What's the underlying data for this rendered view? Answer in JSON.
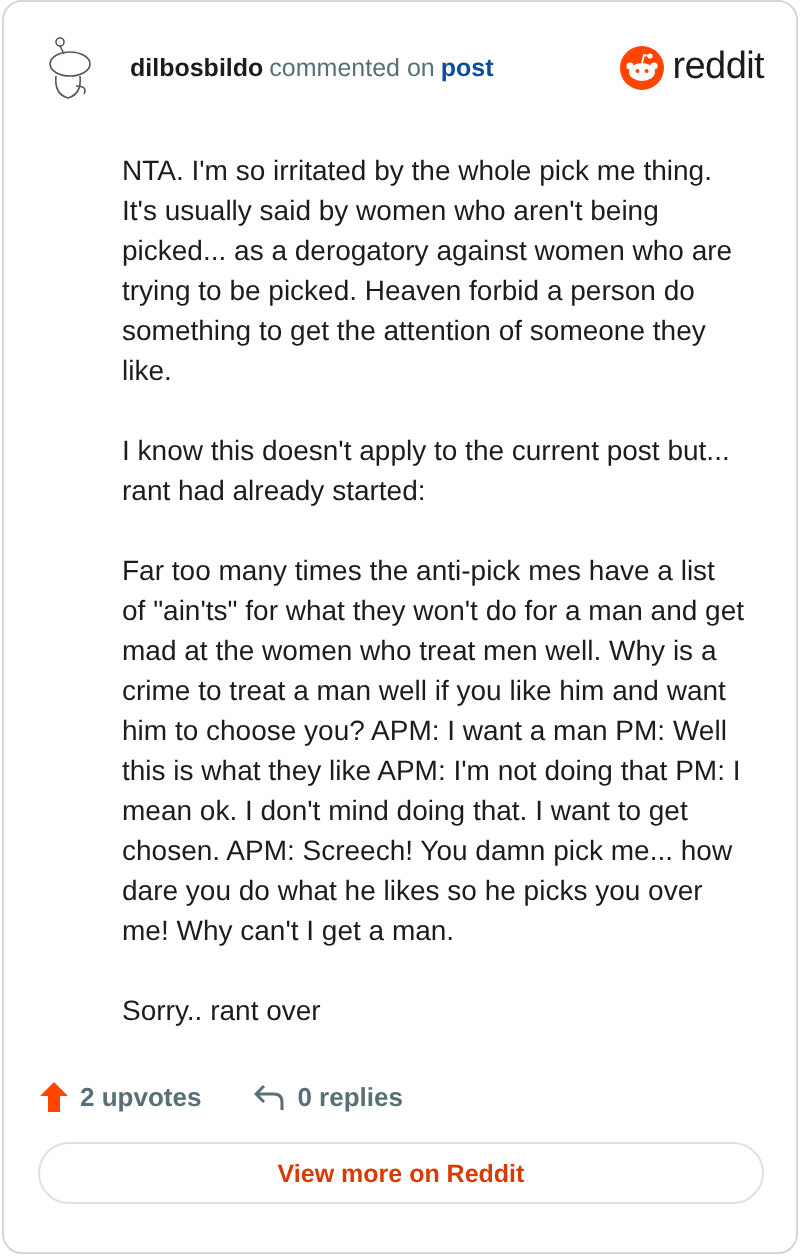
{
  "header": {
    "author": "dilbosbildo",
    "action": "commented on",
    "link": "post",
    "brand": "reddit"
  },
  "paragraphs": [
    "NTA. I'm so irritated by the whole pick me thing. It's usually said by women who aren't being picked... as a derogatory against women who are trying to be picked. Heaven forbid a person do something to get the attention of someone they like.",
    "I know this doesn't apply to the current post but... rant had already started:",
    "Far too many times the anti-pick mes have a list of \"ain'ts\" for what they won't do for a man and get mad at the women who treat men well. Why is a crime to treat a man well if you like him and want him to choose you? APM: I want a man PM: Well this is what they like APM: I'm not doing that PM: I mean ok. I don't mind doing that. I want to get chosen. APM: Screech! You damn pick me... how dare you do what he likes so he picks you over me! Why can't I get a man.",
    "Sorry.. rant over"
  ],
  "stats": {
    "upvotes": "2 upvotes",
    "replies": "0 replies"
  },
  "button": "View more on Reddit"
}
